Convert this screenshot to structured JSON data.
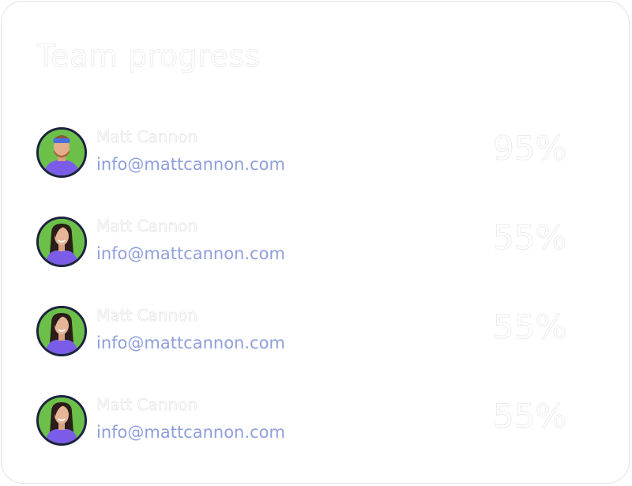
{
  "title": "Team progress",
  "members": [
    {
      "name": "Matt Cannon",
      "email": "info@mattcannon.com",
      "progress": "95%",
      "avatar": "man-headband-avatar"
    },
    {
      "name": "Matt Cannon",
      "email": "info@mattcannon.com",
      "progress": "55%",
      "avatar": "woman-long-hair-avatar"
    },
    {
      "name": "Matt Cannon",
      "email": "info@mattcannon.com",
      "progress": "55%",
      "avatar": "woman-long-hair-avatar"
    },
    {
      "name": "Matt Cannon",
      "email": "info@mattcannon.com",
      "progress": "55%",
      "avatar": "woman-long-hair-avatar"
    }
  ],
  "colors": {
    "avatar_bg": "#6cc04a",
    "avatar_ring": "#1c2240",
    "shirt": "#7b5ce8",
    "email": "#8f9fdc"
  }
}
